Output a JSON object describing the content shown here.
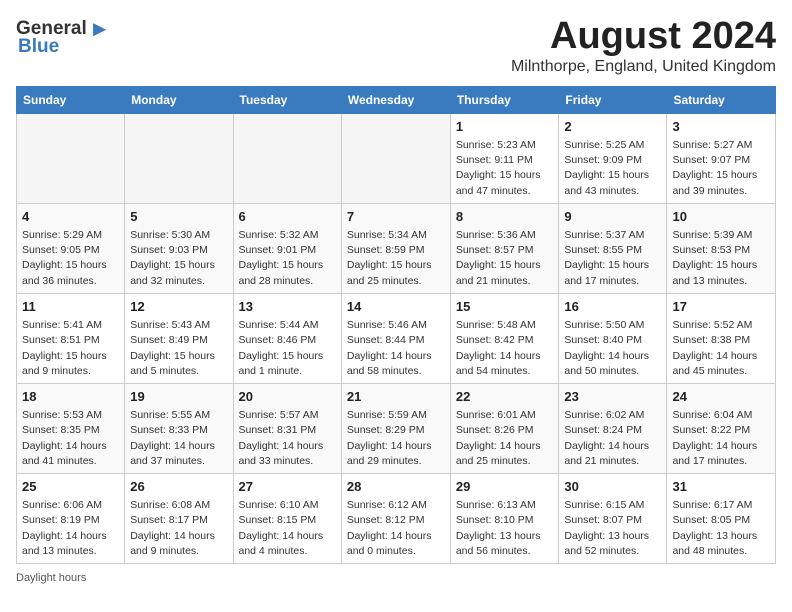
{
  "header": {
    "logo_general": "General",
    "logo_blue": "Blue",
    "month_title": "August 2024",
    "location": "Milnthorpe, England, United Kingdom"
  },
  "calendar": {
    "days_of_week": [
      "Sunday",
      "Monday",
      "Tuesday",
      "Wednesday",
      "Thursday",
      "Friday",
      "Saturday"
    ],
    "weeks": [
      [
        {
          "day": "",
          "info": ""
        },
        {
          "day": "",
          "info": ""
        },
        {
          "day": "",
          "info": ""
        },
        {
          "day": "",
          "info": ""
        },
        {
          "day": "1",
          "info": "Sunrise: 5:23 AM\nSunset: 9:11 PM\nDaylight: 15 hours and 47 minutes."
        },
        {
          "day": "2",
          "info": "Sunrise: 5:25 AM\nSunset: 9:09 PM\nDaylight: 15 hours and 43 minutes."
        },
        {
          "day": "3",
          "info": "Sunrise: 5:27 AM\nSunset: 9:07 PM\nDaylight: 15 hours and 39 minutes."
        }
      ],
      [
        {
          "day": "4",
          "info": "Sunrise: 5:29 AM\nSunset: 9:05 PM\nDaylight: 15 hours and 36 minutes."
        },
        {
          "day": "5",
          "info": "Sunrise: 5:30 AM\nSunset: 9:03 PM\nDaylight: 15 hours and 32 minutes."
        },
        {
          "day": "6",
          "info": "Sunrise: 5:32 AM\nSunset: 9:01 PM\nDaylight: 15 hours and 28 minutes."
        },
        {
          "day": "7",
          "info": "Sunrise: 5:34 AM\nSunset: 8:59 PM\nDaylight: 15 hours and 25 minutes."
        },
        {
          "day": "8",
          "info": "Sunrise: 5:36 AM\nSunset: 8:57 PM\nDaylight: 15 hours and 21 minutes."
        },
        {
          "day": "9",
          "info": "Sunrise: 5:37 AM\nSunset: 8:55 PM\nDaylight: 15 hours and 17 minutes."
        },
        {
          "day": "10",
          "info": "Sunrise: 5:39 AM\nSunset: 8:53 PM\nDaylight: 15 hours and 13 minutes."
        }
      ],
      [
        {
          "day": "11",
          "info": "Sunrise: 5:41 AM\nSunset: 8:51 PM\nDaylight: 15 hours and 9 minutes."
        },
        {
          "day": "12",
          "info": "Sunrise: 5:43 AM\nSunset: 8:49 PM\nDaylight: 15 hours and 5 minutes."
        },
        {
          "day": "13",
          "info": "Sunrise: 5:44 AM\nSunset: 8:46 PM\nDaylight: 15 hours and 1 minute."
        },
        {
          "day": "14",
          "info": "Sunrise: 5:46 AM\nSunset: 8:44 PM\nDaylight: 14 hours and 58 minutes."
        },
        {
          "day": "15",
          "info": "Sunrise: 5:48 AM\nSunset: 8:42 PM\nDaylight: 14 hours and 54 minutes."
        },
        {
          "day": "16",
          "info": "Sunrise: 5:50 AM\nSunset: 8:40 PM\nDaylight: 14 hours and 50 minutes."
        },
        {
          "day": "17",
          "info": "Sunrise: 5:52 AM\nSunset: 8:38 PM\nDaylight: 14 hours and 45 minutes."
        }
      ],
      [
        {
          "day": "18",
          "info": "Sunrise: 5:53 AM\nSunset: 8:35 PM\nDaylight: 14 hours and 41 minutes."
        },
        {
          "day": "19",
          "info": "Sunrise: 5:55 AM\nSunset: 8:33 PM\nDaylight: 14 hours and 37 minutes."
        },
        {
          "day": "20",
          "info": "Sunrise: 5:57 AM\nSunset: 8:31 PM\nDaylight: 14 hours and 33 minutes."
        },
        {
          "day": "21",
          "info": "Sunrise: 5:59 AM\nSunset: 8:29 PM\nDaylight: 14 hours and 29 minutes."
        },
        {
          "day": "22",
          "info": "Sunrise: 6:01 AM\nSunset: 8:26 PM\nDaylight: 14 hours and 25 minutes."
        },
        {
          "day": "23",
          "info": "Sunrise: 6:02 AM\nSunset: 8:24 PM\nDaylight: 14 hours and 21 minutes."
        },
        {
          "day": "24",
          "info": "Sunrise: 6:04 AM\nSunset: 8:22 PM\nDaylight: 14 hours and 17 minutes."
        }
      ],
      [
        {
          "day": "25",
          "info": "Sunrise: 6:06 AM\nSunset: 8:19 PM\nDaylight: 14 hours and 13 minutes."
        },
        {
          "day": "26",
          "info": "Sunrise: 6:08 AM\nSunset: 8:17 PM\nDaylight: 14 hours and 9 minutes."
        },
        {
          "day": "27",
          "info": "Sunrise: 6:10 AM\nSunset: 8:15 PM\nDaylight: 14 hours and 4 minutes."
        },
        {
          "day": "28",
          "info": "Sunrise: 6:12 AM\nSunset: 8:12 PM\nDaylight: 14 hours and 0 minutes."
        },
        {
          "day": "29",
          "info": "Sunrise: 6:13 AM\nSunset: 8:10 PM\nDaylight: 13 hours and 56 minutes."
        },
        {
          "day": "30",
          "info": "Sunrise: 6:15 AM\nSunset: 8:07 PM\nDaylight: 13 hours and 52 minutes."
        },
        {
          "day": "31",
          "info": "Sunrise: 6:17 AM\nSunset: 8:05 PM\nDaylight: 13 hours and 48 minutes."
        }
      ]
    ]
  },
  "footer": {
    "daylight_label": "Daylight hours"
  }
}
